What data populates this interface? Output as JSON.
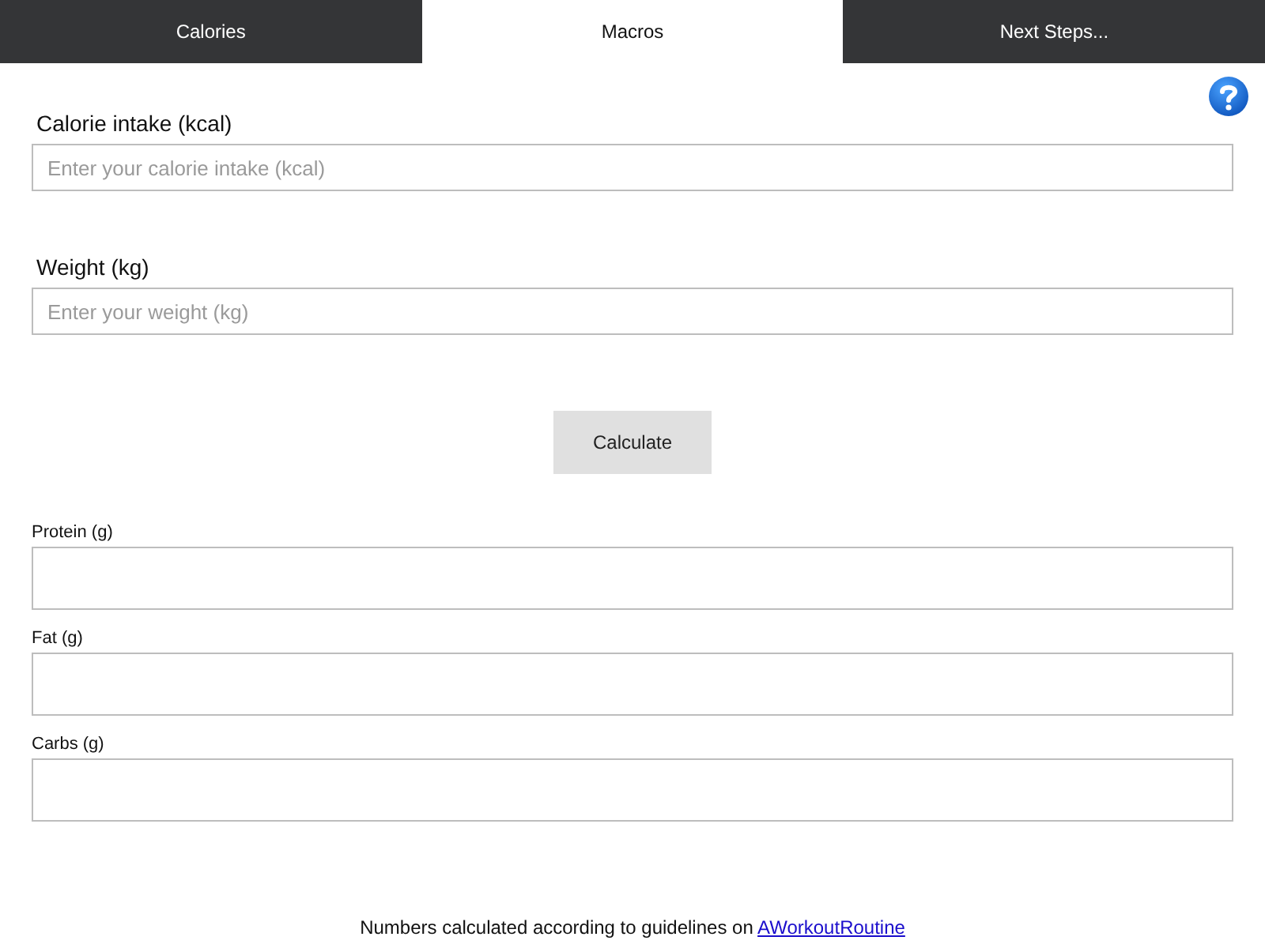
{
  "tabs": [
    {
      "label": "Calories",
      "selected": false
    },
    {
      "label": "Macros",
      "selected": true
    },
    {
      "label": "Next Steps...",
      "selected": false
    }
  ],
  "inputs": [
    {
      "label": "Calorie intake (kcal)",
      "placeholder": "Enter your calorie intake (kcal)"
    },
    {
      "label": "Weight (kg)",
      "placeholder": "Enter your weight (kg)"
    }
  ],
  "calculate_button": "Calculate",
  "results": [
    {
      "label": "Protein (g)"
    },
    {
      "label": "Fat (g)"
    },
    {
      "label": "Carbs (g)"
    }
  ],
  "footer": {
    "text": "Numbers calculated according to guidelines on",
    "link": "AWorkoutRoutine"
  }
}
